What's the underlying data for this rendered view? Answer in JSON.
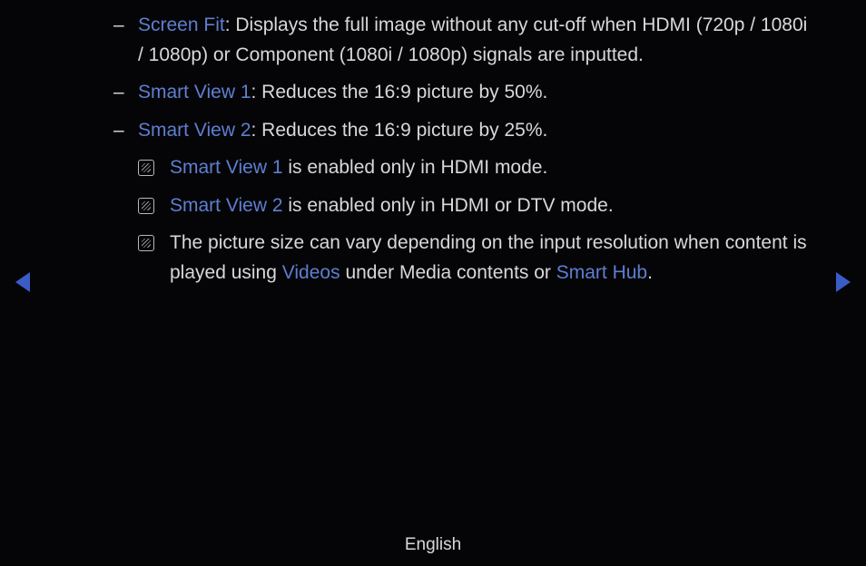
{
  "items": [
    {
      "term": "Screen Fit",
      "desc": ": Displays the full image without any cut-off when HDMI (720p / 1080i / 1080p) or Component (1080i / 1080p) signals are inputted."
    },
    {
      "term": "Smart View 1",
      "desc": ": Reduces the 16:9 picture by 50%."
    },
    {
      "term": "Smart View 2",
      "desc": ": Reduces the 16:9 picture by 25%."
    }
  ],
  "notes": [
    {
      "term": "Smart View 1",
      "desc": " is enabled only in HDMI mode."
    },
    {
      "term": "Smart View 2",
      "desc": " is enabled only in HDMI or DTV mode."
    }
  ],
  "note3": {
    "pre": "The picture size can vary depending on the input resolution when content is played using ",
    "videos": "Videos",
    "mid": " under Media contents or ",
    "hub": "Smart Hub",
    "post": "."
  },
  "footer": "English",
  "bullet": "–"
}
